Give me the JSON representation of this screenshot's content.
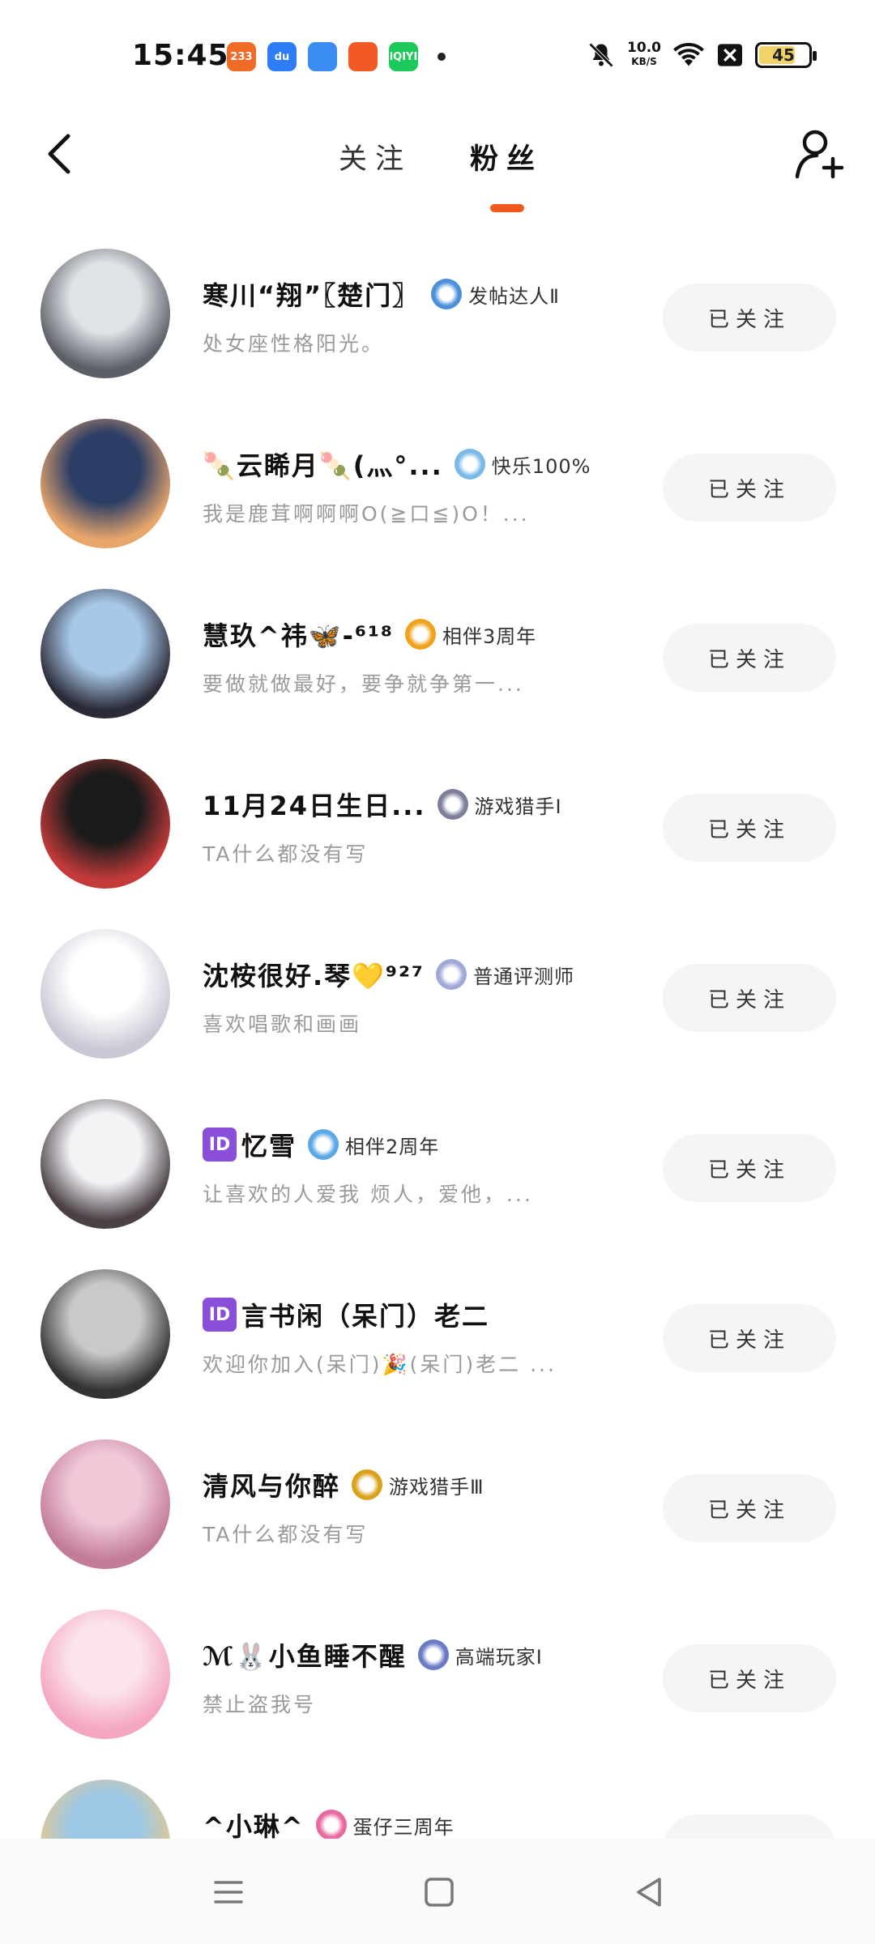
{
  "status_bar": {
    "time": "15:45",
    "app_icons": [
      {
        "name": "233-app-icon",
        "label": "233",
        "color": "#ef6b27"
      },
      {
        "name": "baidu-app-icon",
        "label": "du",
        "color": "#2e7cf6"
      },
      {
        "name": "browser-app-icon",
        "label": "",
        "color": "#3b8cf3"
      },
      {
        "name": "kuaishou-app-icon",
        "label": "",
        "color": "#f15a24"
      },
      {
        "name": "iqiyi-app-icon",
        "label": "iQIYI",
        "color": "#1ec95b"
      }
    ],
    "network_speed": "10.0",
    "network_unit": "KB/S",
    "battery": "45"
  },
  "header": {
    "tab_following": "关注",
    "tab_fans": "粉丝",
    "accent_color": "#f25a1c"
  },
  "fans": [
    {
      "name": "寒川“翔”〖楚门〗",
      "badge": "发帖达人Ⅱ",
      "badge_color": "#4a90d9",
      "bio": "处女座性格阳光。",
      "button": "已关注",
      "id_tag": "",
      "avatar_colors": [
        "#dfe3e8",
        "#5b5f66"
      ]
    },
    {
      "name": "🍡云睎月🍡(灬°...",
      "badge": "快乐100%",
      "badge_color": "#7ab8e8",
      "bio": "我是鹿茸啊啊啊O(≧口≦)O！...",
      "button": "已关注",
      "id_tag": "",
      "avatar_colors": [
        "#2c3e66",
        "#e8a66b"
      ]
    },
    {
      "name": "慧玖^祎🦋-⁶¹⁸",
      "badge": "相伴3周年",
      "badge_color": "#f0a21c",
      "bio": "要做就做最好，要争就争第一...",
      "button": "已关注",
      "id_tag": "",
      "avatar_colors": [
        "#a8c8e8",
        "#2b2b38"
      ]
    },
    {
      "name": "11月24日生日...",
      "badge": "游戏猎手Ⅰ",
      "badge_color": "#7c7f9a",
      "bio": "TA什么都没有写",
      "button": "已关注",
      "id_tag": "",
      "avatar_colors": [
        "#1b1b1b",
        "#c43a3a"
      ]
    },
    {
      "name": "沈桉很好.琴💛⁹²⁷",
      "badge": "普通评测师",
      "badge_color": "#a0a8d8",
      "bio": "喜欢唱歌和画画",
      "button": "已关注",
      "id_tag": "",
      "avatar_colors": [
        "#ffffff",
        "#c9c9d6"
      ]
    },
    {
      "name": "忆雪",
      "badge": "相伴2周年",
      "badge_color": "#5aa8e6",
      "bio": "让喜欢的人爱我 烦人，爱他，...",
      "button": "已关注",
      "id_tag": "ID",
      "avatar_colors": [
        "#f3f3f6",
        "#4a4046"
      ]
    },
    {
      "name": "言书闲（呆门）老二",
      "badge": "",
      "badge_color": "",
      "bio": "欢迎你加入(呆门)🎉(呆门)老二 ...",
      "button": "已关注",
      "id_tag": "ID",
      "avatar_colors": [
        "#c9c9c9",
        "#333333"
      ]
    },
    {
      "name": "清风与你醉",
      "badge": "游戏猎手Ⅲ",
      "badge_color": "#d9a21c",
      "bio": "TA什么都没有写",
      "button": "已关注",
      "id_tag": "",
      "avatar_colors": [
        "#f0c8d8",
        "#c27b98"
      ]
    },
    {
      "name": "ℳ🐰小鱼睡不醒",
      "badge": "高端玩家Ⅰ",
      "badge_color": "#6b7ac4",
      "bio": "禁止盗我号",
      "button": "已关注",
      "id_tag": "",
      "avatar_colors": [
        "#fbe4ec",
        "#f4a6c0"
      ]
    },
    {
      "name": "^小琳^",
      "badge": "蛋仔三周年",
      "badge_color": "#e86aa0",
      "bio": "",
      "button": "",
      "id_tag": "",
      "avatar_colors": [
        "#9cc8e6",
        "#e8c88a"
      ]
    }
  ],
  "nav": {
    "menu": "menu-icon",
    "home": "home-icon",
    "back": "back-icon"
  }
}
